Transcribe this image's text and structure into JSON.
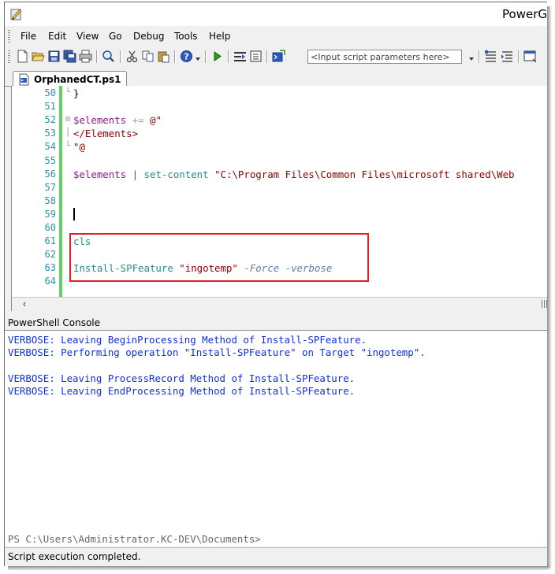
{
  "window": {
    "title": "PowerG",
    "accent_green": "#61d161",
    "highlight_color": "#e02020"
  },
  "menu": {
    "items": [
      {
        "label": "File"
      },
      {
        "label": "Edit"
      },
      {
        "label": "View"
      },
      {
        "label": "Go"
      },
      {
        "label": "Debug"
      },
      {
        "label": "Tools"
      },
      {
        "label": "Help"
      }
    ]
  },
  "toolbar": {
    "icons": [
      "new-file-icon",
      "open-folder-icon",
      "save-icon",
      "save-all-icon",
      "print-icon",
      "find-icon",
      "cut-icon",
      "copy-icon",
      "paste-icon",
      "help-icon",
      "dropdown-arrow-icon",
      "run-icon",
      "step-into-icon",
      "step-over-icon",
      "start-powershell-icon",
      "dropdown-arrow-icon",
      "list-icon",
      "indent-icon",
      "window-icon"
    ],
    "params_placeholder": "<Input script parameters here>"
  },
  "tab": {
    "label": "OrphanedCT.ps1",
    "icon": "script-file-icon"
  },
  "editor": {
    "lines": [
      {
        "num": "50",
        "tokens": [
          {
            "t": "}",
            "c": "#000000"
          }
        ]
      },
      {
        "num": "51",
        "tokens": []
      },
      {
        "num": "52",
        "tokens": [
          {
            "t": "$elements",
            "c": "#8b1a8b"
          },
          {
            "t": " ",
            "c": "#000000"
          },
          {
            "t": "+=",
            "c": "#a0a0a0"
          },
          {
            "t": " ",
            "c": "#000000"
          },
          {
            "t": "@\"",
            "c": "#8b0000"
          }
        ]
      },
      {
        "num": "53",
        "tokens": [
          {
            "t": "</Elements>",
            "c": "#8b0000"
          }
        ]
      },
      {
        "num": "54",
        "tokens": [
          {
            "t": "\"@",
            "c": "#8b0000"
          }
        ]
      },
      {
        "num": "55",
        "tokens": []
      },
      {
        "num": "56",
        "tokens": [
          {
            "t": "$elements",
            "c": "#8b1a8b"
          },
          {
            "t": " | ",
            "c": "#505050"
          },
          {
            "t": "set-content",
            "c": "#2b8a8a"
          },
          {
            "t": " ",
            "c": "#000000"
          },
          {
            "t": "\"C:\\Program Files\\Common Files\\microsoft shared\\Web",
            "c": "#8b0000"
          }
        ]
      },
      {
        "num": "57",
        "tokens": []
      },
      {
        "num": "58",
        "tokens": []
      },
      {
        "num": "59",
        "tokens": []
      },
      {
        "num": "60",
        "tokens": []
      },
      {
        "num": "61",
        "tokens": [
          {
            "t": "cls",
            "c": "#2b8a8a"
          }
        ]
      },
      {
        "num": "62",
        "tokens": []
      },
      {
        "num": "63",
        "tokens": [
          {
            "t": "Install-SPFeature",
            "c": "#2b8a8a"
          },
          {
            "t": " ",
            "c": "#000000"
          },
          {
            "t": "\"ingotemp\"",
            "c": "#8b0000"
          },
          {
            "t": " ",
            "c": "#000000"
          },
          {
            "t": "-Force",
            "c": "#5a7fa8",
            "i": true
          },
          {
            "t": " ",
            "c": "#000000"
          },
          {
            "t": "-verbose",
            "c": "#5a7fa8",
            "i": true
          }
        ]
      },
      {
        "num": "64",
        "tokens": []
      }
    ]
  },
  "console": {
    "title": "PowerShell Console",
    "lines": [
      "VERBOSE: Leaving BeginProcessing Method of Install-SPFeature.",
      "VERBOSE: Performing operation \"Install-SPFeature\" on Target \"ingotemp\".",
      "",
      "VERBOSE: Leaving ProcessRecord Method of Install-SPFeature.",
      "VERBOSE: Leaving EndProcessing Method of Install-SPFeature."
    ],
    "prompt": "PS C:\\Users\\Administrator.KC-DEV\\Documents>"
  },
  "status": {
    "text": "Script execution completed."
  }
}
